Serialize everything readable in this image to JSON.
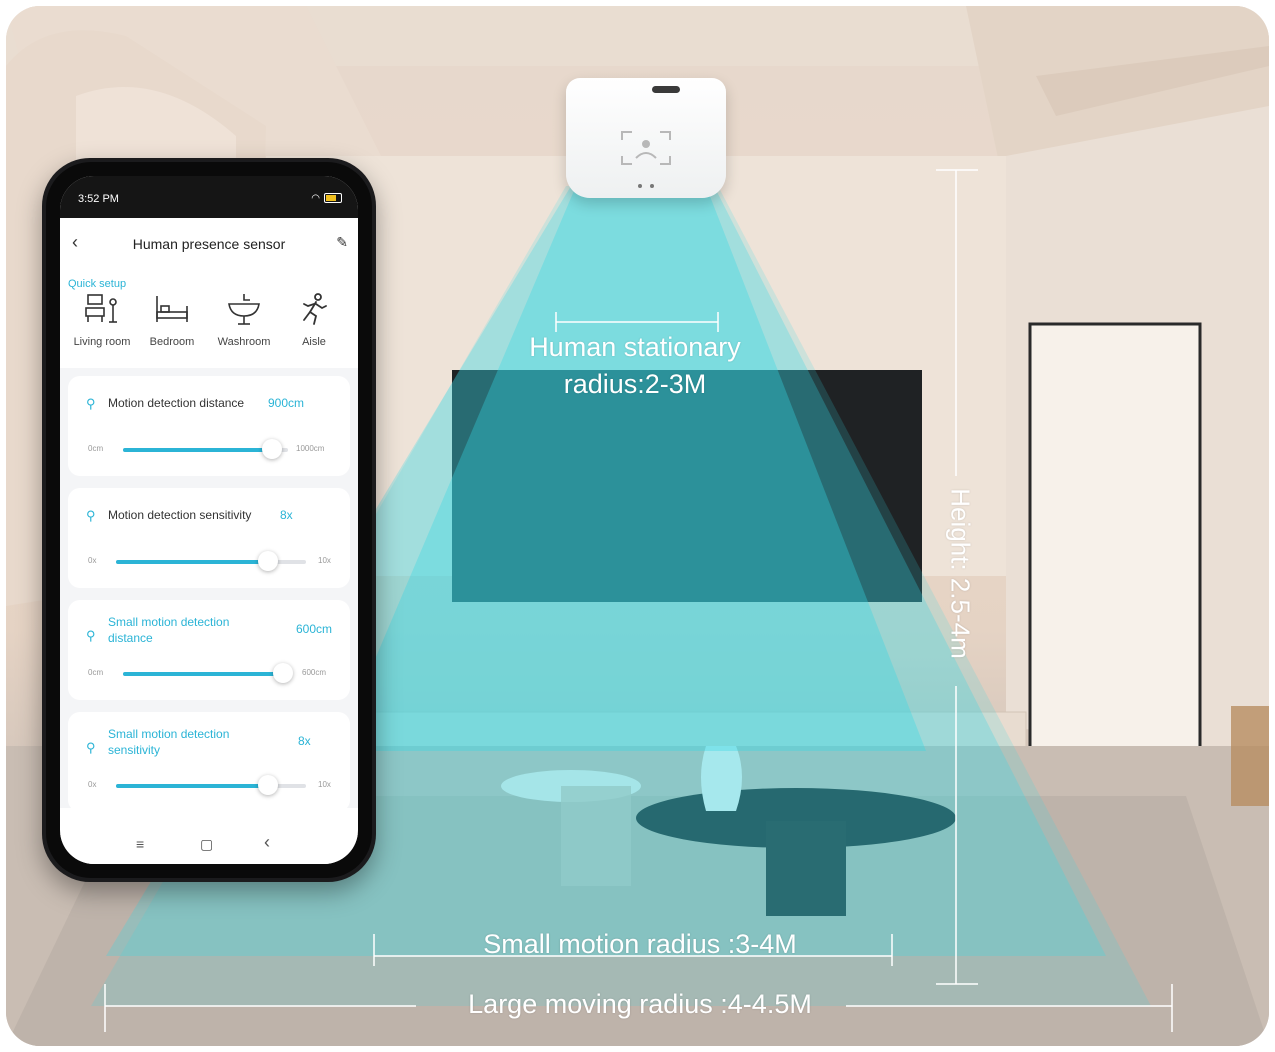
{
  "scene": {
    "stationary_label_line1": "Human stationary",
    "stationary_label_line2": "radius:2-3M",
    "small_motion_label": "Small motion radius :3-4M",
    "large_moving_label": "Large moving radius :4-4.5M",
    "height_label": "Height: 2.5-4m"
  },
  "colors": {
    "beam": "#35d6e6",
    "accent": "#2bb4d6"
  },
  "phone": {
    "status": {
      "time": "3:52 PM",
      "icons": "wifi-icon battery-icon"
    },
    "header": {
      "title": "Human presence sensor",
      "back_icon": "chevron-left-icon",
      "edit_icon": "pencil-icon"
    },
    "quick_setup": {
      "label": "Quick setup",
      "items": [
        {
          "label": "Living room",
          "icon": "living-room-icon"
        },
        {
          "label": "Bedroom",
          "icon": "bed-icon"
        },
        {
          "label": "Washroom",
          "icon": "sink-icon"
        },
        {
          "label": "Aisle",
          "icon": "running-person-icon"
        }
      ]
    },
    "settings": [
      {
        "title": "Motion detection distance",
        "value": "900cm",
        "min": "0cm",
        "max": "1000cm",
        "fraction": 0.9
      },
      {
        "title": "Motion detection sensitivity",
        "value": "8x",
        "min": "0x",
        "max": "10x",
        "fraction": 0.8
      },
      {
        "title_line1": "Small motion detection",
        "title_line2": "distance",
        "value": "600cm",
        "min": "0cm",
        "max": "600cm",
        "fraction": 1.0
      },
      {
        "title_line1": "Small motion detection",
        "title_line2": "sensitivity",
        "value": "8x",
        "min": "0x",
        "max": "10x",
        "fraction": 0.8
      }
    ],
    "navbar": {
      "menu_icon": "≡",
      "home_icon": "▢",
      "back_icon": "‹"
    }
  }
}
